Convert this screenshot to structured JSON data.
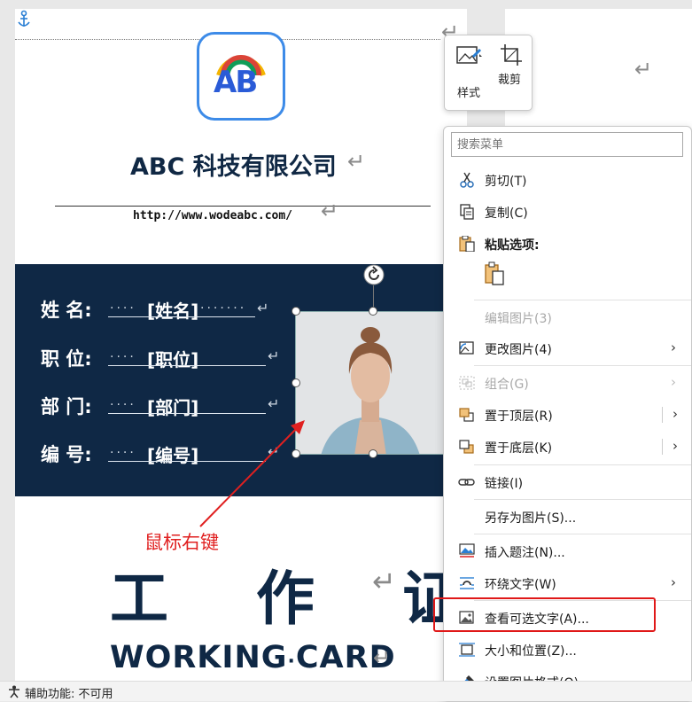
{
  "document": {
    "company_name": "ABC 科技有限公司",
    "website": "http://www.wodeabc.com/",
    "logo_text": "AB",
    "fields": [
      {
        "label": "姓 名:",
        "value": "[姓名]"
      },
      {
        "label": "职 位:",
        "value": "[职位]"
      },
      {
        "label": "部 门:",
        "value": "[部门]"
      },
      {
        "label": "编 号:",
        "value": "[编号]"
      }
    ],
    "title": "工 作 证",
    "subtitle_left": "WORKING",
    "subtitle_dot": "·",
    "subtitle_right": "CARD",
    "pilcrow": "↵",
    "annotation": "鼠标右键"
  },
  "mini_toolbar": {
    "style_label": "样式",
    "crop_label": "裁剪"
  },
  "context_menu": {
    "search_placeholder": "搜索菜单",
    "items": [
      {
        "label": "剪切(T)",
        "icon": "scissors-icon"
      },
      {
        "label": "复制(C)",
        "icon": "copy-icon"
      },
      {
        "label": "粘贴选项:",
        "icon": "paste-icon"
      },
      {
        "label": "编辑图片(3)",
        "icon": ""
      },
      {
        "label": "更改图片(4)",
        "icon": "change-picture-icon"
      },
      {
        "label": "组合(G)",
        "icon": "group-icon"
      },
      {
        "label": "置于顶层(R)",
        "icon": "bring-front-icon"
      },
      {
        "label": "置于底层(K)",
        "icon": "send-back-icon"
      },
      {
        "label": "链接(I)",
        "icon": "link-icon"
      },
      {
        "label": "另存为图片(S)...",
        "icon": ""
      },
      {
        "label": "插入题注(N)...",
        "icon": "caption-icon"
      },
      {
        "label": "环绕文字(W)",
        "icon": "wrap-text-icon"
      },
      {
        "label": "查看可选文字(A)...",
        "icon": "alt-text-icon"
      },
      {
        "label": "大小和位置(Z)...",
        "icon": "size-position-icon"
      },
      {
        "label": "设置图片格式(O)...",
        "icon": "format-picture-icon"
      }
    ],
    "arrow": "›"
  },
  "status_bar": {
    "accessibility": "辅助功能: 不可用"
  }
}
